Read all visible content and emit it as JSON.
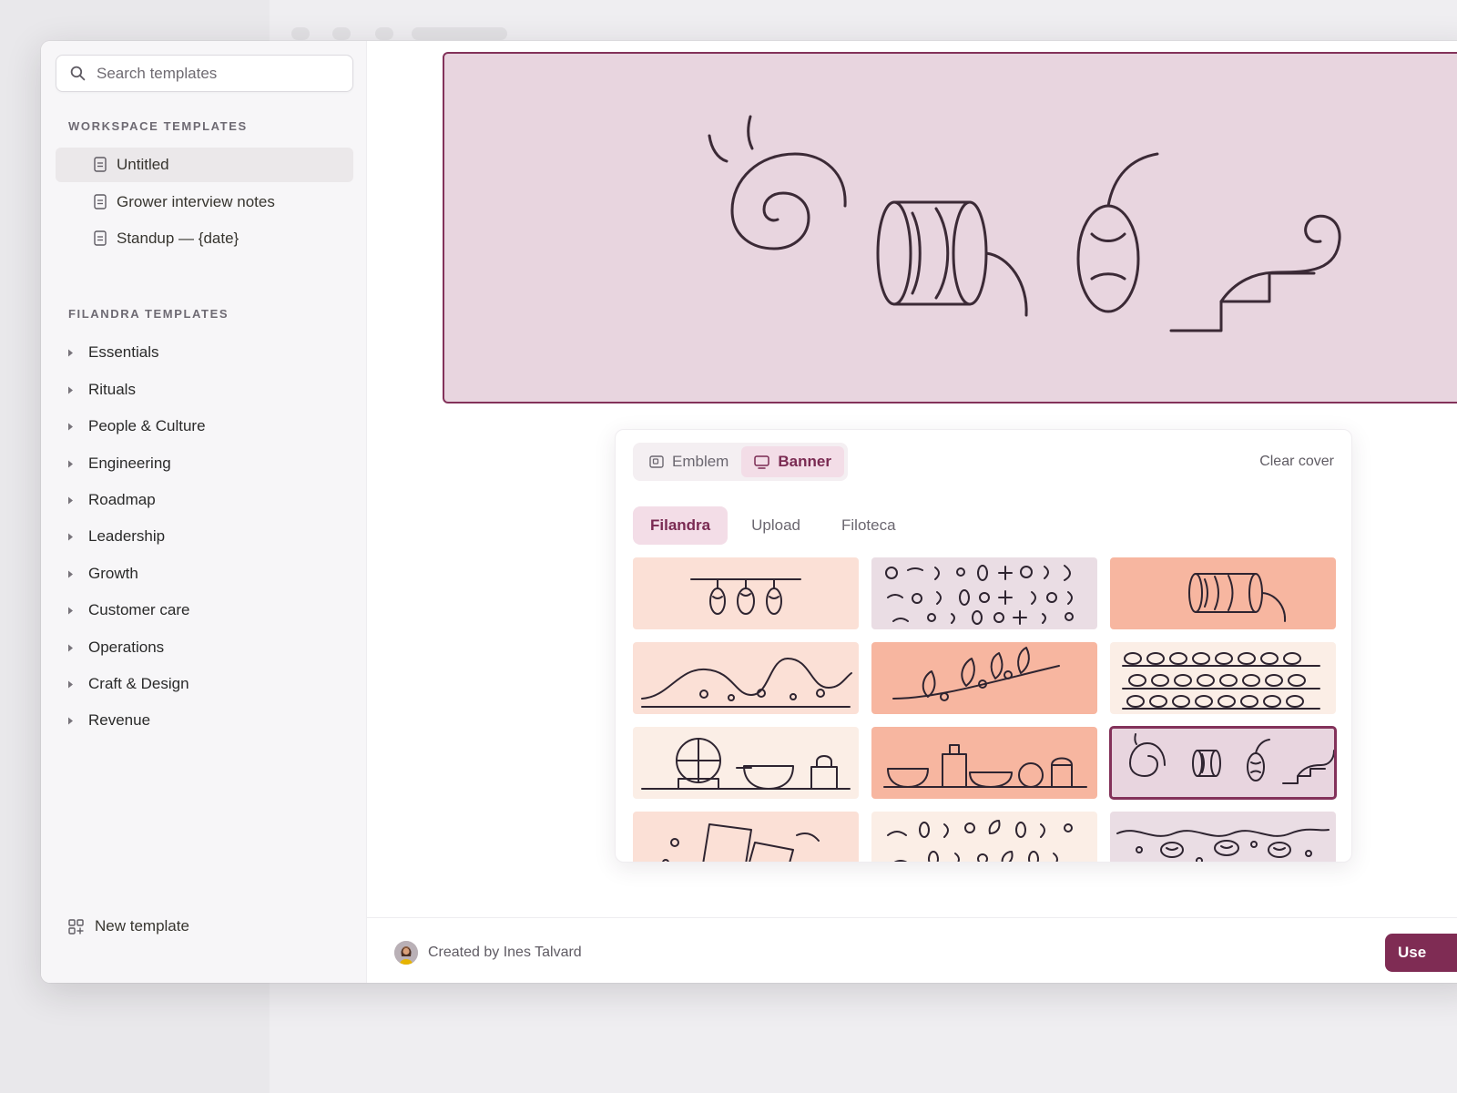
{
  "sidebar": {
    "search_placeholder": "Search templates",
    "workspace_label": "WORKSPACE TEMPLATES",
    "workspace_items": [
      {
        "label": "Untitled",
        "icon": "document-icon",
        "active": true
      },
      {
        "label": "Grower interview notes",
        "icon": "document-icon",
        "active": false
      },
      {
        "label": "Standup — {date}",
        "icon": "document-icon",
        "active": false
      }
    ],
    "filandra_label": "FILANDRA TEMPLATES",
    "categories": [
      "Essentials",
      "Rituals",
      "People & Culture",
      "Engineering",
      "Roadmap",
      "Leadership",
      "Growth",
      "Customer care",
      "Operations",
      "Craft & Design",
      "Revenue"
    ],
    "new_template_label": "New template"
  },
  "picker": {
    "mode_tabs": [
      {
        "label": "Emblem",
        "icon": "emblem-icon",
        "active": false
      },
      {
        "label": "Banner",
        "icon": "banner-icon",
        "active": true
      }
    ],
    "clear_label": "Clear cover",
    "source_tabs": [
      {
        "label": "Filandra",
        "active": true
      },
      {
        "label": "Upload",
        "active": false
      },
      {
        "label": "Filoteca",
        "active": false
      }
    ],
    "thumbnails": [
      {
        "name": "hanging-lanterns",
        "bg": "#fbe0d6"
      },
      {
        "name": "scattered-glyphs",
        "bg": "#eadde4"
      },
      {
        "name": "spool-thread",
        "bg": "#f7b6a0"
      },
      {
        "name": "rolling-hills",
        "bg": "#fbe0d6"
      },
      {
        "name": "leafy-vine",
        "bg": "#f7b6a0"
      },
      {
        "name": "pebble-rows",
        "bg": "#fbeee6"
      },
      {
        "name": "still-life",
        "bg": "#fbeee6"
      },
      {
        "name": "pottery-shelf",
        "bg": "#f7b6a0"
      },
      {
        "name": "spiral-stairs",
        "bg": "#e8d5df",
        "selected": true
      },
      {
        "name": "folded-papers",
        "bg": "#fbe0d6"
      },
      {
        "name": "leaf-scatter",
        "bg": "#fbeee6"
      },
      {
        "name": "wavy-pebbles",
        "bg": "#eadde4"
      }
    ]
  },
  "cover": {
    "bg": "#e8d5df",
    "border": "#83325a"
  },
  "footer": {
    "creator_text": "Created by Ines Talvard",
    "use_button": "Use"
  },
  "colors": {
    "accent": "#7f2c54",
    "accent_light": "#f3dde7"
  }
}
